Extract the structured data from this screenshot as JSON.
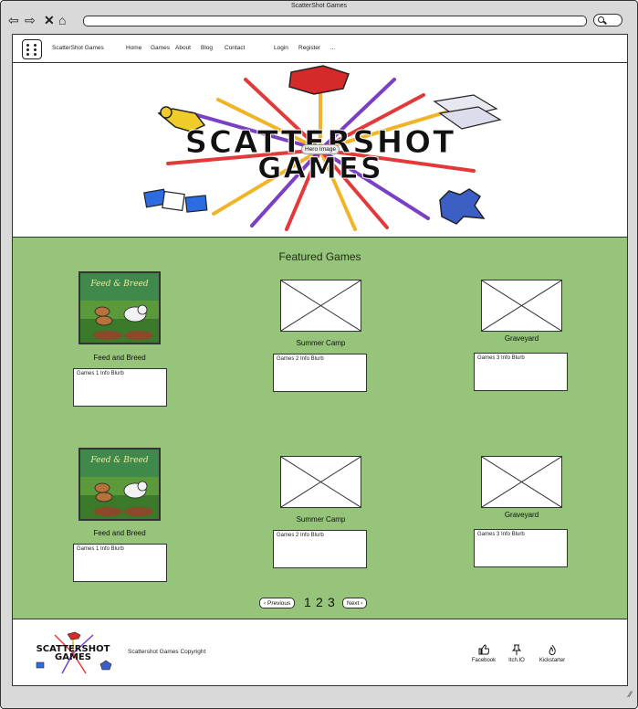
{
  "window": {
    "title": "ScatterShot Games"
  },
  "browser": {
    "back_icon": "arrow-left-icon",
    "forward_icon": "arrow-right-icon",
    "close_icon": "x-icon",
    "home_icon": "home-icon",
    "address": ""
  },
  "header": {
    "brand": "ScatterShot Games",
    "nav": [
      "Home",
      "Games",
      "About",
      "Blog",
      "Contact"
    ],
    "auth": [
      "Login",
      "Register"
    ],
    "more": "..."
  },
  "hero": {
    "logo_line1": "SCATTERSHOT",
    "logo_line2": "GAMES",
    "label": "Hero Image"
  },
  "featured": {
    "title": "Featured Games",
    "rows": [
      {
        "games": [
          {
            "title": "Feed and Breed",
            "blurb": "Games 1 Info Blurb",
            "art_text": "Feed & Breed"
          },
          {
            "title": "Summer Camp",
            "blurb": "Games 2 Info Blurb"
          },
          {
            "title": "Graveyard",
            "blurb": "Games 3 Info Blurb"
          }
        ]
      },
      {
        "games": [
          {
            "title": "Feed and Breed",
            "blurb": "Games 1 Info Blurb",
            "art_text": "Feed & Breed"
          },
          {
            "title": "Summer Camp",
            "blurb": "Games 2 Info Blurb"
          },
          {
            "title": "Graveyard",
            "blurb": "Games 3 Info Blurb"
          }
        ]
      }
    ],
    "pager": {
      "prev": "Previous",
      "next": "Next",
      "pages": [
        "1",
        "2",
        "3"
      ]
    }
  },
  "footer": {
    "logo_line1": "SCATTERSHOT",
    "logo_line2": "GAMES",
    "copyright": "Scattershot Games Copyright",
    "social": [
      {
        "label": "Facebook",
        "icon": "thumbs-up-icon"
      },
      {
        "label": "Itch.IO",
        "icon": "pin-icon"
      },
      {
        "label": "Kickstarter",
        "icon": "flame-icon"
      }
    ]
  },
  "colors": {
    "section_bg": "#96c47a",
    "frame": "#d9d9d9"
  }
}
